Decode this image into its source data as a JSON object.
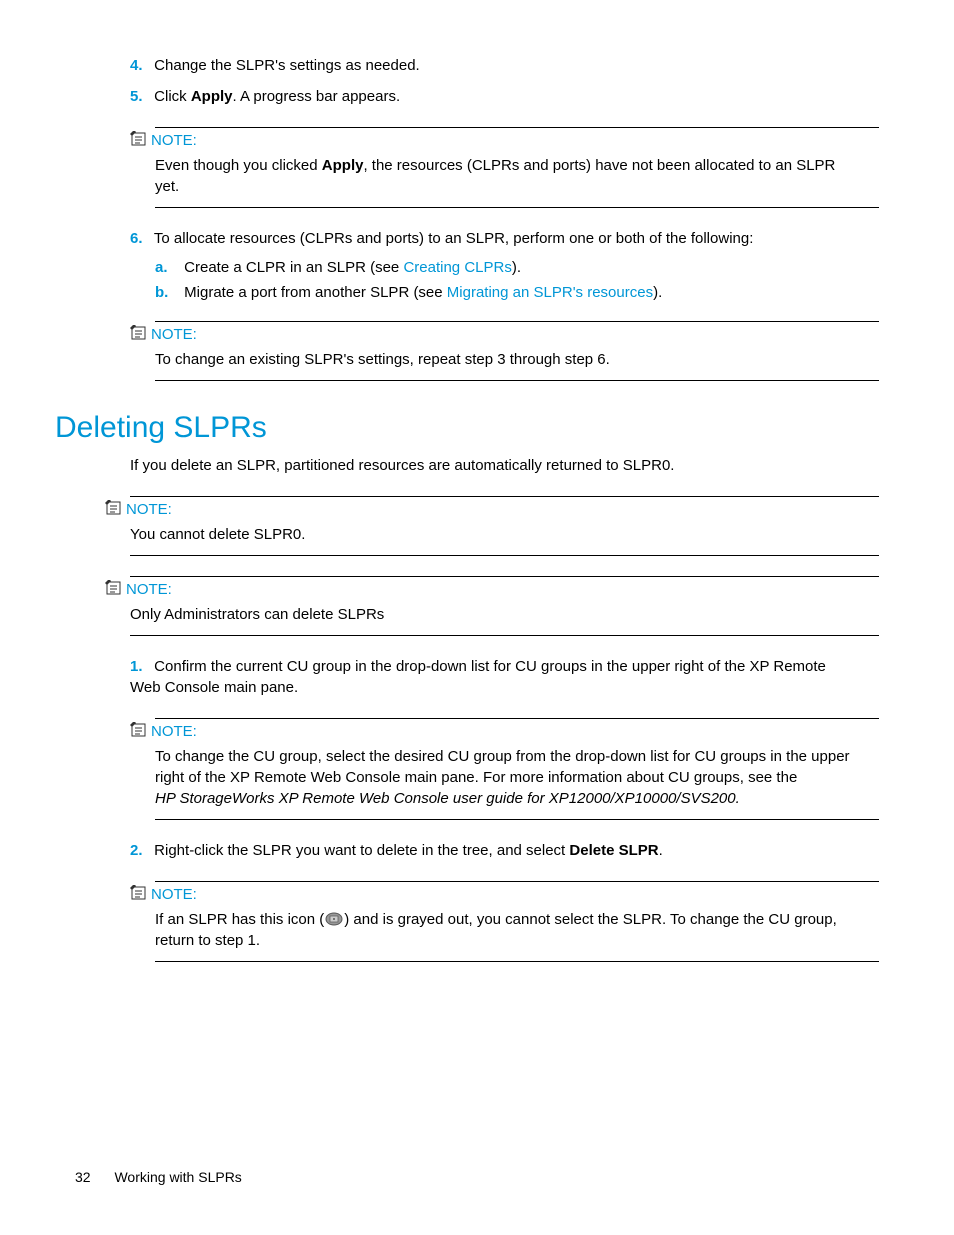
{
  "steps_top": {
    "s4": {
      "num": "4.",
      "text": "Change the SLPR's settings as needed."
    },
    "s5": {
      "num": "5.",
      "pre": "Click ",
      "bold": "Apply",
      "post": ". A progress bar appears."
    },
    "s6": {
      "num": "6.",
      "text": "To allocate resources (CLPRs and ports) to an SLPR, perform one or both of the following:",
      "a": {
        "alpha": "a.",
        "pre": "Create a CLPR in an SLPR (see ",
        "link": "Creating CLPRs",
        "post": ")."
      },
      "b": {
        "alpha": "b.",
        "pre": "Migrate a port from another SLPR (see ",
        "link": "Migrating an SLPR's resources",
        "post": ")."
      }
    }
  },
  "note1": {
    "label": "NOTE:",
    "body_pre": "Even though you clicked ",
    "body_bold": "Apply",
    "body_post": ", the resources (CLPRs and ports) have not been allocated to an SLPR yet."
  },
  "note2": {
    "label": "NOTE:",
    "body": "To change an existing SLPR's settings, repeat step 3 through step 6."
  },
  "heading": "Deleting SLPRs",
  "intro": "If you delete an SLPR, partitioned resources are automatically returned to SLPR0.",
  "note3": {
    "label": "NOTE:",
    "body": "You cannot delete SLPR0."
  },
  "note4": {
    "label": "NOTE:",
    "body": "Only Administrators can delete SLPRs"
  },
  "steps_del": {
    "s1": {
      "num": "1.",
      "text": "Confirm the current CU group in the drop-down list for CU groups in the upper right of the XP Remote Web Console main pane."
    },
    "s2": {
      "num": "2.",
      "pre": "Right-click the SLPR you want to delete in the tree, and select ",
      "bold": "Delete SLPR",
      "post": "."
    }
  },
  "note5": {
    "label": "NOTE:",
    "body": "To change the CU group, select the desired CU group from the drop-down list for CU groups in the upper right of the XP Remote Web Console main pane. For more information about CU groups, see the",
    "italic": "HP StorageWorks XP Remote Web Console user guide for XP12000/XP10000/SVS200."
  },
  "note6": {
    "label": "NOTE:",
    "pre": "If an SLPR has this icon (",
    "post": ") and is grayed out, you cannot select the SLPR. To change the CU group, return to step 1."
  },
  "footer": {
    "page": "32",
    "title": "Working with SLPRs"
  }
}
